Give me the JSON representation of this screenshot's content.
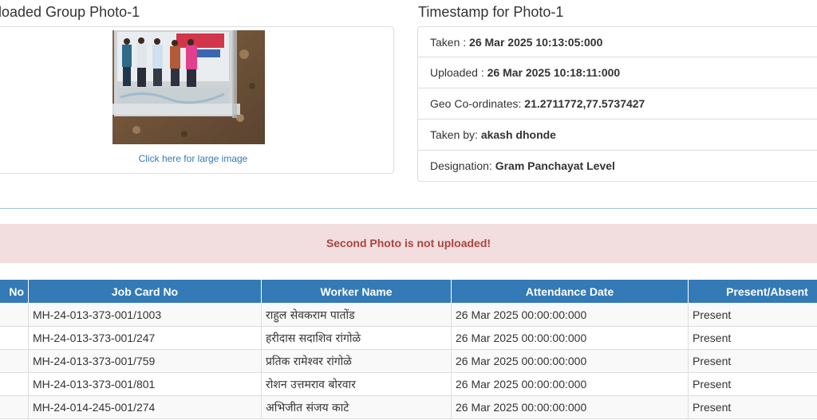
{
  "photo_section": {
    "heading": "loaded Group Photo-1",
    "link_text": "Click here for large image"
  },
  "timestamp_section": {
    "heading": "Timestamp for Photo-1",
    "items": [
      {
        "label": "Taken : ",
        "value": "26 Mar 2025 10:13:05:000"
      },
      {
        "label": "Uploaded : ",
        "value": "26 Mar 2025 10:18:11:000"
      },
      {
        "label": "Geo Co-ordinates: ",
        "value": "21.2711772,77.5737427"
      },
      {
        "label": "Taken by: ",
        "value": "akash dhonde"
      },
      {
        "label": "Designation: ",
        "value": "Gram Panchayat Level"
      }
    ]
  },
  "alert": {
    "message": "Second Photo is not uploaded!",
    "color": "#a94442",
    "background": "#f2dede"
  },
  "table": {
    "header_color": "#337ab7",
    "columns": [
      "No",
      "Job Card No",
      "Worker Name",
      "Attendance Date",
      "Present/Absent"
    ],
    "rows": [
      {
        "no": "",
        "job_card": "MH-24-013-373-001/1003",
        "name": "राहुल सेवकराम पातोंड",
        "date": "26 Mar 2025 00:00:00:000",
        "status": "Present"
      },
      {
        "no": "",
        "job_card": "MH-24-013-373-001/247",
        "name": "हरीदास सदाशिव रांगोळे",
        "date": "26 Mar 2025 00:00:00:000",
        "status": "Present"
      },
      {
        "no": "",
        "job_card": "MH-24-013-373-001/759",
        "name": "प्रतिक रामेश्वर रांगोळे",
        "date": "26 Mar 2025 00:00:00:000",
        "status": "Present"
      },
      {
        "no": "",
        "job_card": "MH-24-013-373-001/801",
        "name": "रोशन उत्तमराव बोरवार",
        "date": "26 Mar 2025 00:00:00:000",
        "status": "Present"
      },
      {
        "no": "",
        "job_card": "MH-24-014-245-001/274",
        "name": "अभिजीत संजय काटे",
        "date": "26 Mar 2025 00:00:00:000",
        "status": "Present"
      }
    ]
  }
}
